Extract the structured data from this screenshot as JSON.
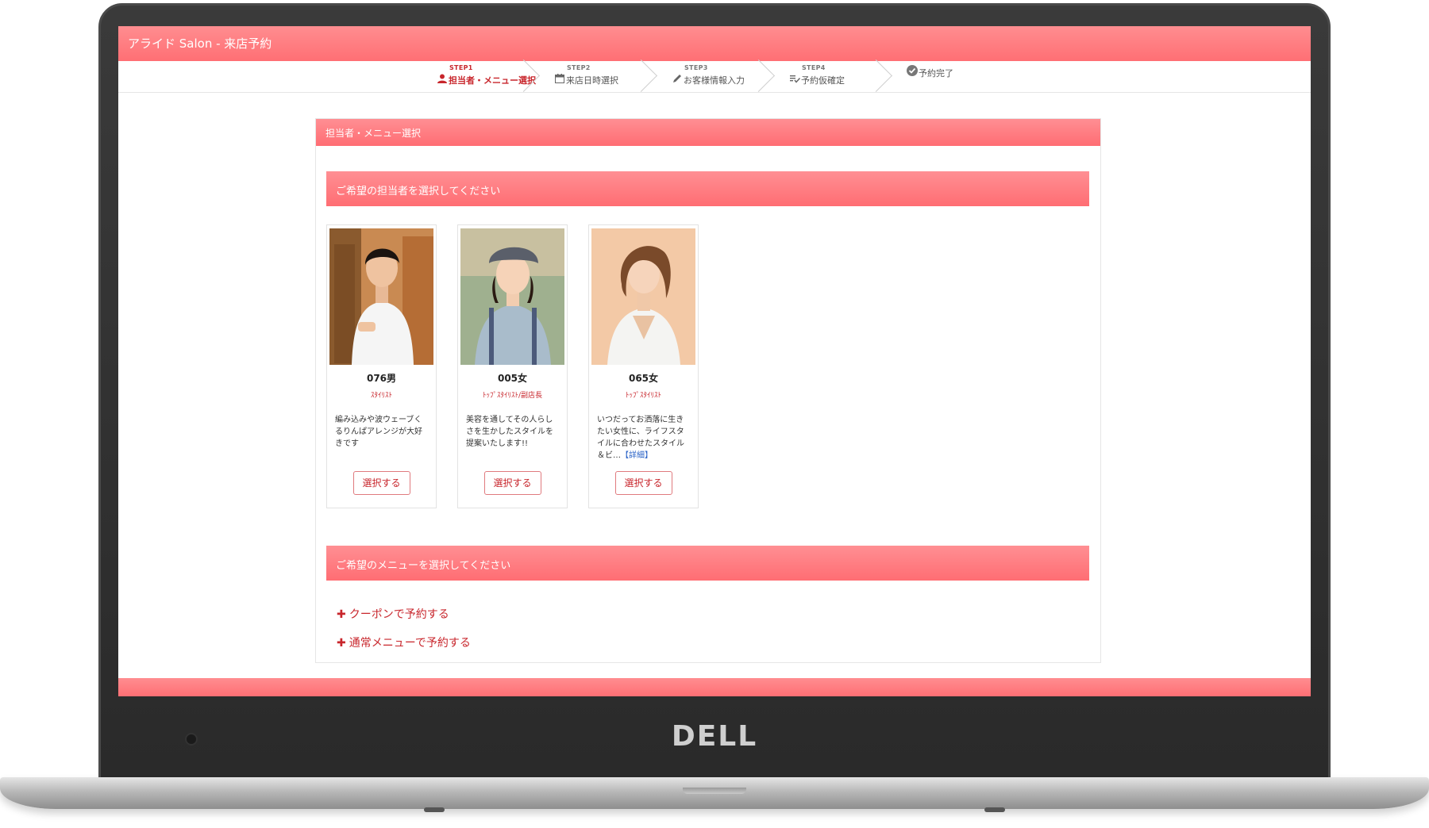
{
  "app": {
    "title": "アライド Salon - 来店予約"
  },
  "device": {
    "brand": "DELL"
  },
  "steps": [
    {
      "num": "STEP1",
      "label": "担当者・メニュー選択",
      "icon": "person-icon",
      "active": true
    },
    {
      "num": "STEP2",
      "label": "来店日時選択",
      "icon": "calendar-icon",
      "active": false
    },
    {
      "num": "STEP3",
      "label": "お客様情報入力",
      "icon": "pencil-icon",
      "active": false
    },
    {
      "num": "STEP4",
      "label": "予約仮確定",
      "icon": "list-check-icon",
      "active": false
    },
    {
      "num": "",
      "label": "予約完了",
      "icon": "check-circle-icon",
      "active": false
    }
  ],
  "panel": {
    "title": "担当者・メニュー選択"
  },
  "staff_section": {
    "title": "ご希望の担当者を選択してください"
  },
  "staff": [
    {
      "name": "076男",
      "role": "ｽﾀｲﾘｽﾄ",
      "desc": "編み込みや波ウェーブくるりんぱアレンジが大好きです",
      "detail": "",
      "select": "選択する"
    },
    {
      "name": "005女",
      "role": "ﾄｯﾌﾟｽﾀｲﾘｽﾄ/副店長",
      "desc": "美容を通してその人らしさを生かしたスタイルを提案いたします!!",
      "detail": "",
      "select": "選択する"
    },
    {
      "name": "065女",
      "role": "ﾄｯﾌﾟｽﾀｲﾘｽﾄ",
      "desc": "いつだってお洒落に生きたい女性に、ライフスタイルに合わせたスタイル＆ビ…",
      "detail": "【詳細】",
      "select": "選択する"
    }
  ],
  "menu_section": {
    "title": "ご希望のメニューを選択してください"
  },
  "menu_links": [
    {
      "label": "クーポンで予約する"
    },
    {
      "label": "通常メニューで予約する"
    }
  ],
  "colors": {
    "accent": "#ff7579",
    "accent_text": "#c8262c",
    "link": "#2a63c7"
  }
}
